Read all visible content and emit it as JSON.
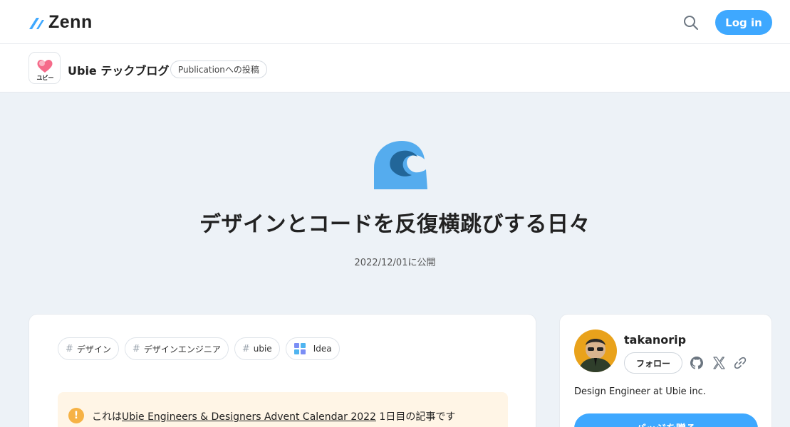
{
  "header": {
    "logo_text": "Zenn",
    "login_label": "Log in",
    "brand_color": "#3ea8ff"
  },
  "publication": {
    "name": "Ubie テックブログ",
    "badge": "Publicationへの投稿",
    "logo_text": "ユビー"
  },
  "article": {
    "emoji": "wave-emoji",
    "title": "デザインとコードを反復横跳びする日々",
    "published": "2022/12/01に公開",
    "topics": [
      {
        "label": "デザイン",
        "type": "hash"
      },
      {
        "label": "デザインエンジニア",
        "type": "hash"
      },
      {
        "label": "ubie",
        "type": "hash"
      },
      {
        "label": "Idea",
        "type": "icon"
      }
    ],
    "message": {
      "prefix": "これは",
      "link": "Ubie Engineers & Designers Advent Calendar 2022",
      "suffix": " 1日目の記事です"
    }
  },
  "author": {
    "name": "takanorip",
    "follow_label": "フォロー",
    "bio": "Design Engineer at Ubie inc.",
    "badge_label": "バッジを贈る"
  },
  "icons": {
    "search": "search-icon",
    "github": "github-icon",
    "x": "x-icon",
    "link": "link-icon",
    "warning": "exclamation-icon"
  }
}
